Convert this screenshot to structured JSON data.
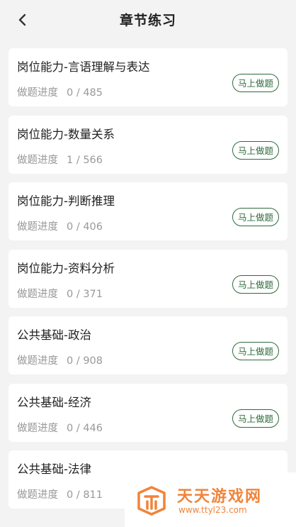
{
  "header": {
    "title": "章节练习",
    "back_icon": "chevron-left-icon"
  },
  "progress_label": "做题进度",
  "button_label": "马上做题",
  "chapters": [
    {
      "title": "岗位能力-言语理解与表达",
      "progress": "0 / 485"
    },
    {
      "title": "岗位能力-数量关系",
      "progress": "1 / 566"
    },
    {
      "title": "岗位能力-判断推理",
      "progress": "0 / 406"
    },
    {
      "title": "岗位能力-资料分析",
      "progress": "0 / 371"
    },
    {
      "title": "公共基础-政治",
      "progress": "0 / 908"
    },
    {
      "title": "公共基础-经济",
      "progress": "0 / 446"
    },
    {
      "title": "公共基础-法律",
      "progress": "0 / 811"
    }
  ],
  "watermark": {
    "name": "天天游戏网",
    "url": "www.ttyl23.com"
  },
  "colors": {
    "accent": "#2f6b3c",
    "background": "#f3f3f3",
    "watermark": "#f0843a"
  }
}
